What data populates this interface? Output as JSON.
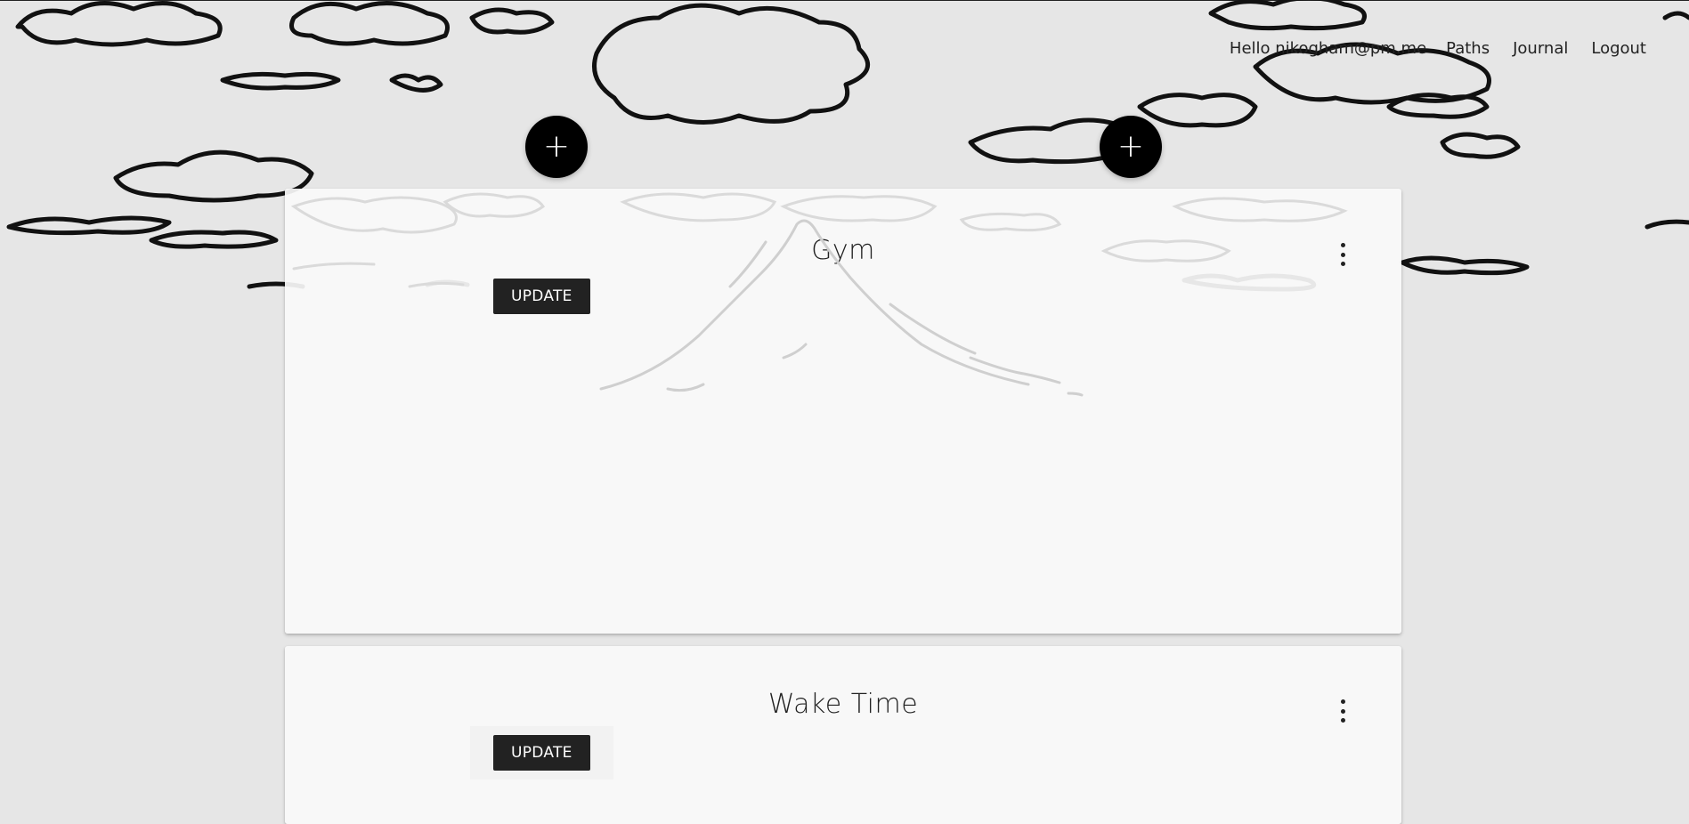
{
  "nav": {
    "greeting": "Hello nikogham@pm.me",
    "paths": "Paths",
    "journal": "Journal",
    "logout": "Logout"
  },
  "fab": {
    "label": "+"
  },
  "cards": [
    {
      "title": "Gym",
      "update_label": "UPDATE"
    },
    {
      "title": "Wake Time",
      "update_label": "UPDATE"
    }
  ],
  "icons": {
    "add": "plus-icon",
    "menu": "more-vert-icon"
  },
  "colors": {
    "background": "#e6e6e6",
    "card": "#fafafa",
    "button": "#222222",
    "fab": "#000000"
  }
}
